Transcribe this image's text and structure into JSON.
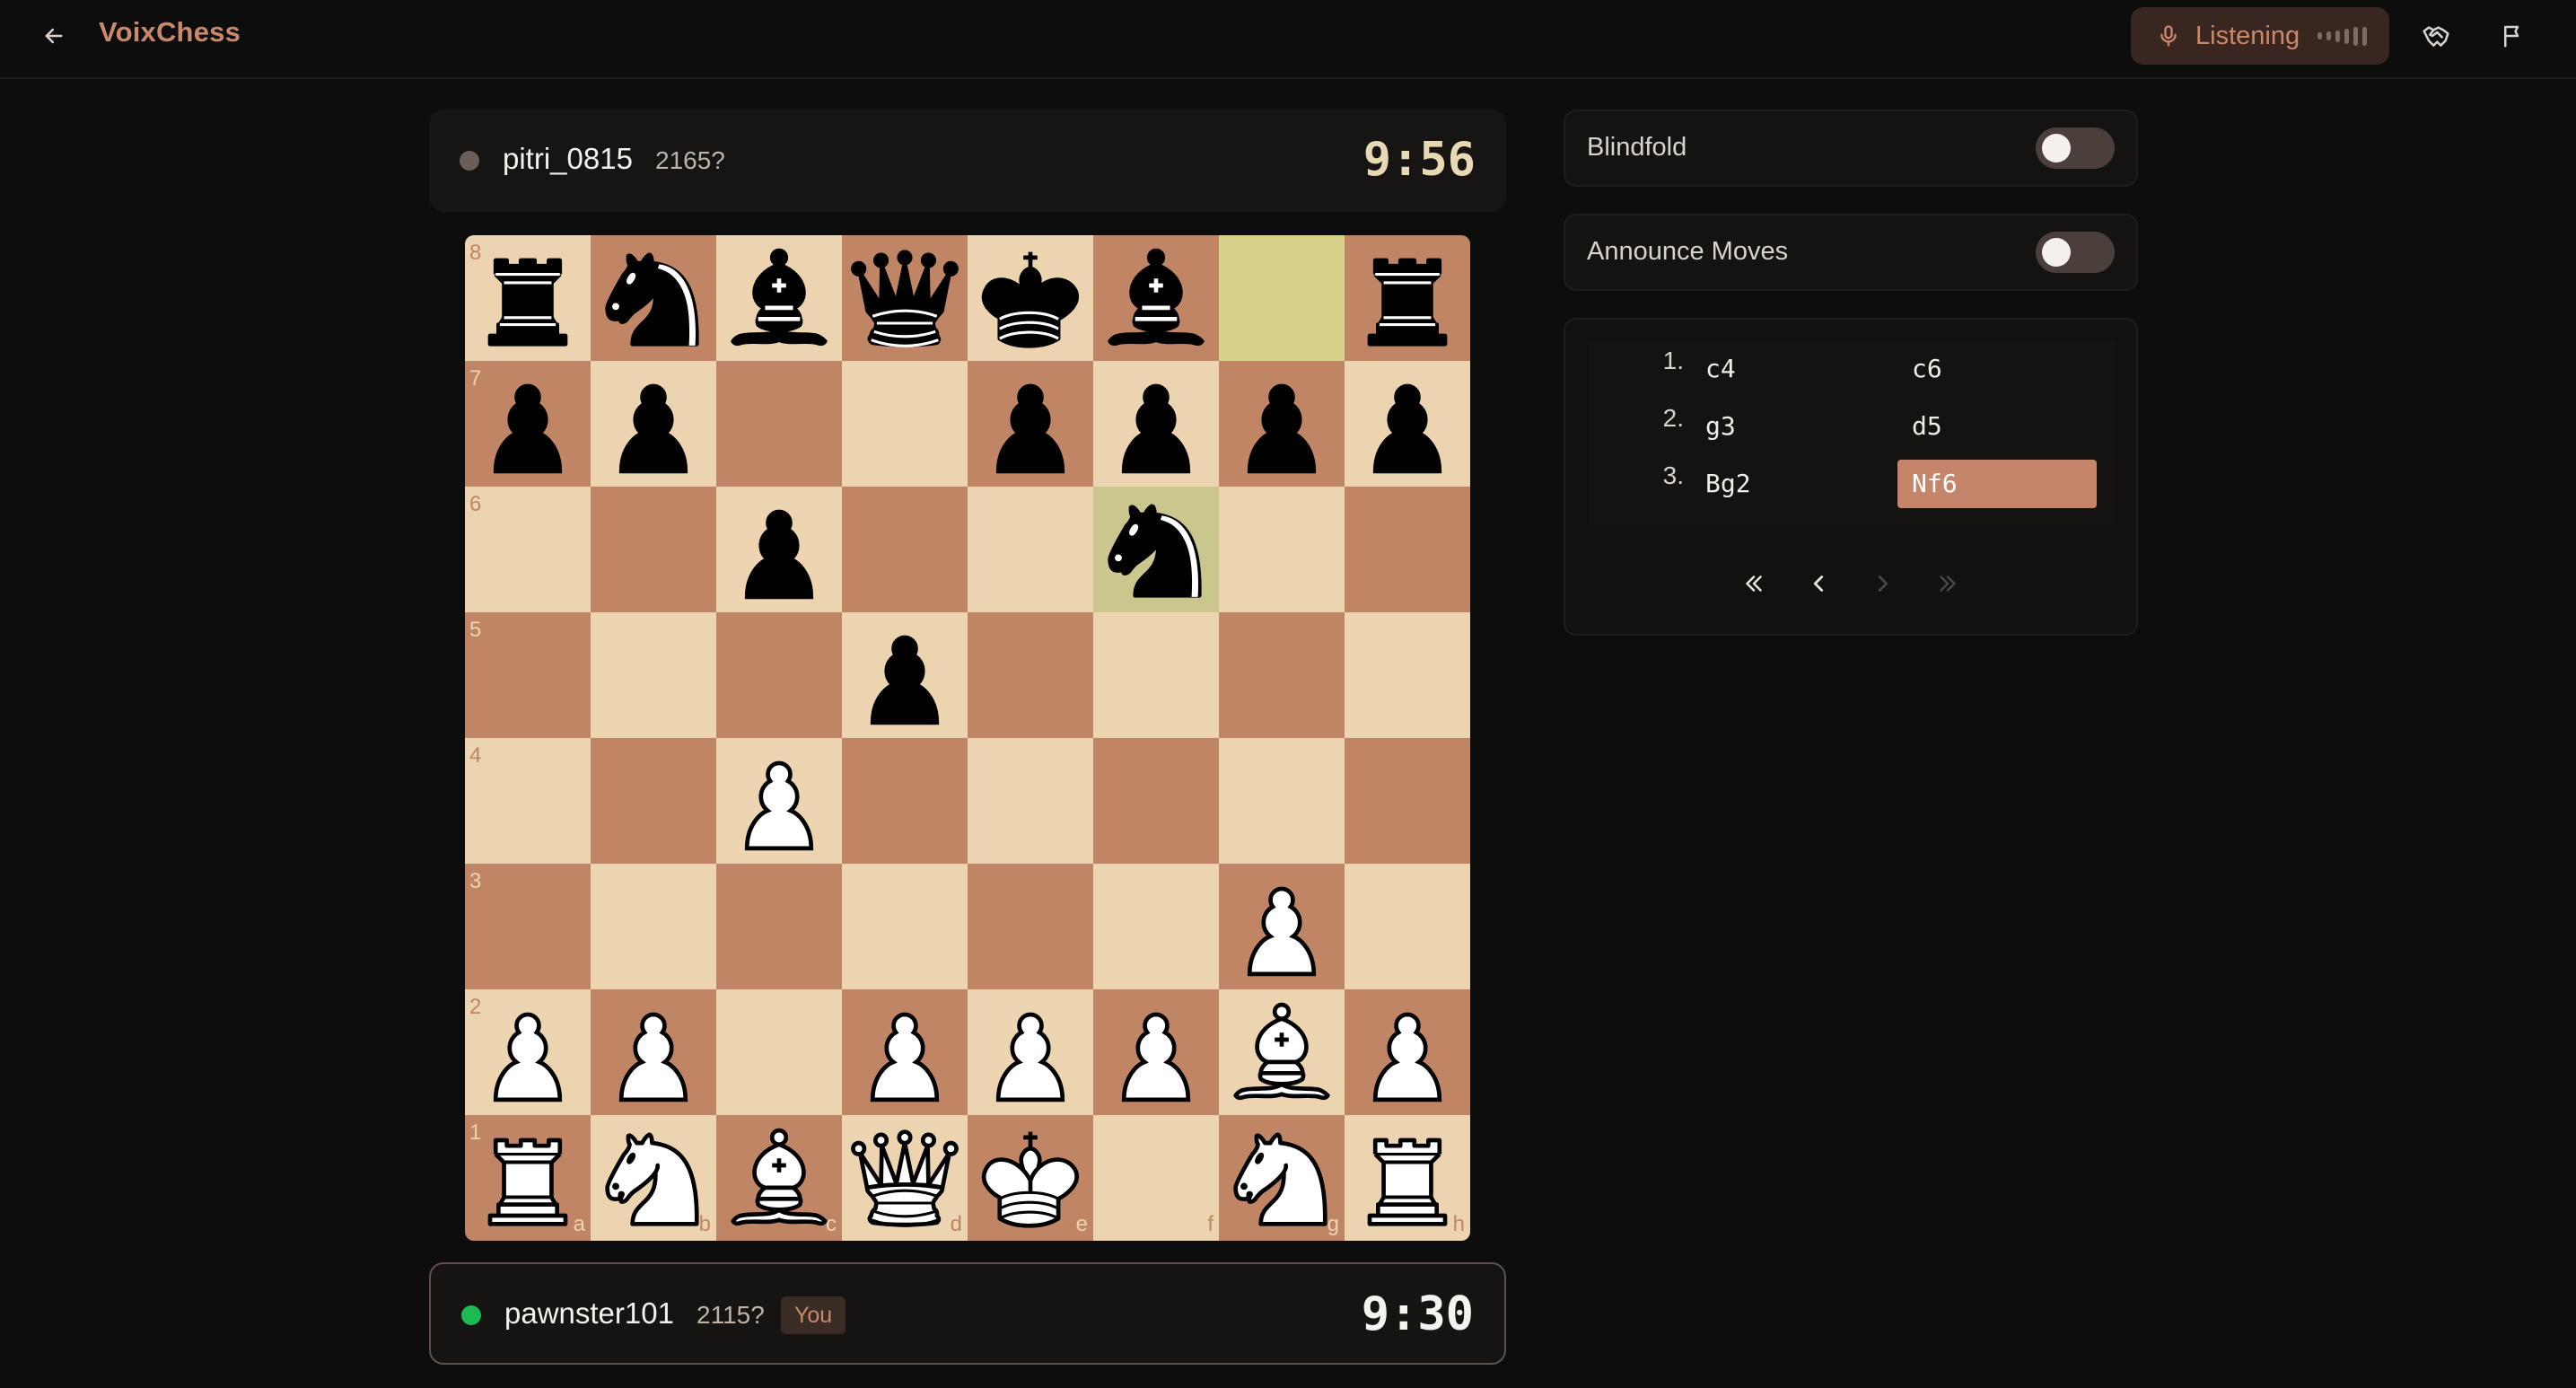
{
  "header": {
    "app_title": "VoixChess",
    "listening_label": "Listening",
    "icons": [
      "arrow-left-icon",
      "microphone-icon",
      "audio-level-icon",
      "handshake-icon",
      "flag-icon"
    ]
  },
  "opponent": {
    "name": "pitri_0815",
    "rating": "2165?",
    "clock": "9:56",
    "status_color": "#6b5e57"
  },
  "player": {
    "name": "pawnster101",
    "rating": "2115?",
    "badge": "You",
    "clock": "9:30",
    "status_color": "#1db954"
  },
  "board": {
    "ranks": [
      "8",
      "7",
      "6",
      "5",
      "4",
      "3",
      "2",
      "1"
    ],
    "files": [
      "a",
      "b",
      "c",
      "d",
      "e",
      "f",
      "g",
      "h"
    ],
    "position": [
      [
        "bR",
        "bN",
        "bB",
        "bQ",
        "bK",
        "bB",
        "",
        "bR"
      ],
      [
        "bP",
        "bP",
        "",
        "",
        "bP",
        "bP",
        "bP",
        "bP"
      ],
      [
        "",
        "",
        "bP",
        "",
        "",
        "bN",
        "",
        ""
      ],
      [
        "",
        "",
        "",
        "bP",
        "",
        "",
        "",
        ""
      ],
      [
        "",
        "",
        "wP",
        "",
        "",
        "",
        "",
        ""
      ],
      [
        "",
        "",
        "",
        "",
        "",
        "",
        "wP",
        ""
      ],
      [
        "wP",
        "wP",
        "",
        "wP",
        "wP",
        "wP",
        "wB",
        "wP"
      ],
      [
        "wR",
        "wN",
        "wB",
        "wQ",
        "wK",
        "",
        "wN",
        "wR"
      ]
    ],
    "last_move": {
      "from": "g8",
      "to": "f6"
    },
    "colors": {
      "light": "#ecd4b0",
      "dark": "#bf8565",
      "highlight": "#d8d18a"
    }
  },
  "settings": [
    {
      "label": "Blindfold",
      "enabled": false
    },
    {
      "label": "Announce Moves",
      "enabled": false
    }
  ],
  "moves": [
    {
      "number": "1.",
      "white": "c4",
      "black": "c6"
    },
    {
      "number": "2.",
      "white": "g3",
      "black": "d5"
    },
    {
      "number": "3.",
      "white": "Bg2",
      "black": "Nf6"
    }
  ],
  "active_move": "Nf6",
  "navigation": [
    "first-move-icon",
    "previous-move-icon",
    "next-move-icon",
    "last-move-icon"
  ],
  "accent_color": "#c9896a"
}
